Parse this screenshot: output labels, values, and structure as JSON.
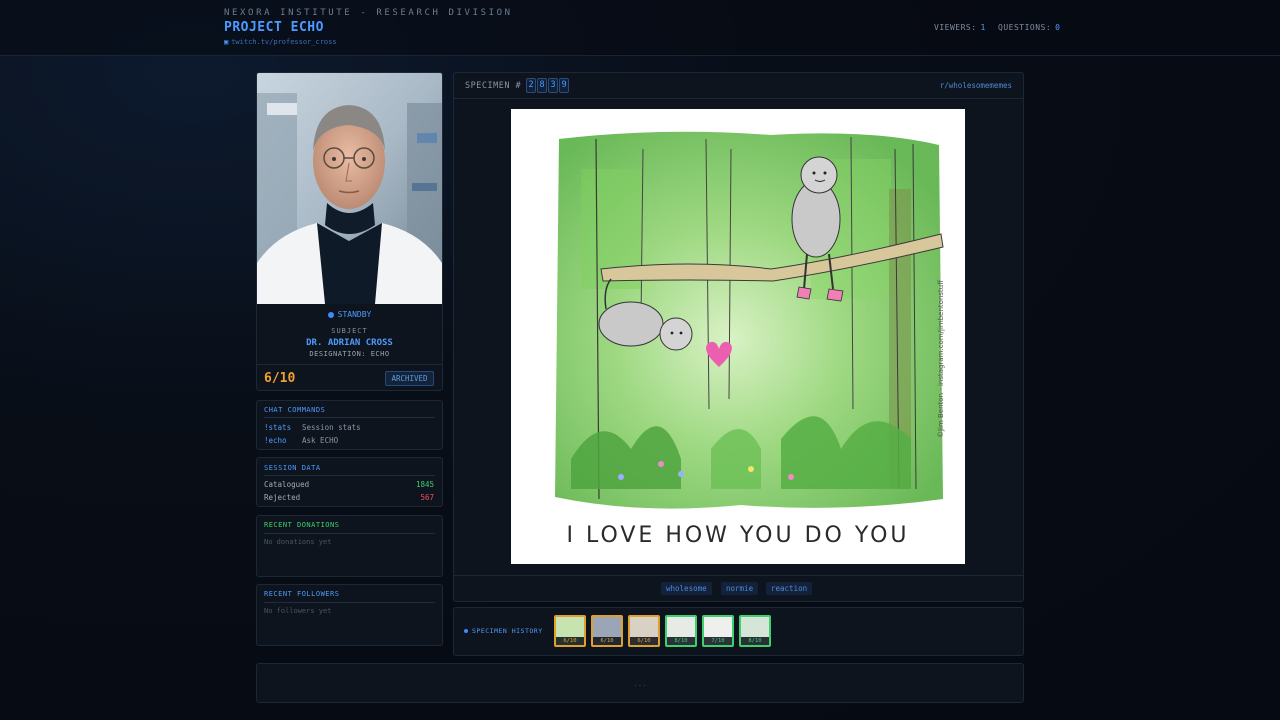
{
  "header": {
    "org": "NEXORA INSTITUTE - RESEARCH DIVISION",
    "project": "PROJECT ECHO",
    "channel": "twitch.tv/professor_cross",
    "viewers_label": "VIEWERS:",
    "viewers": "1",
    "questions_label": "QUESTIONS:",
    "questions": "0"
  },
  "subject": {
    "status": "STANDBY",
    "label": "SUBJECT",
    "name": "DR. ADRIAN CROSS",
    "designation": "DESIGNATION: ECHO",
    "score": "6/10",
    "badge": "ARCHIVED"
  },
  "commands": {
    "title": "CHAT COMMANDS",
    "items": [
      {
        "cmd": "!stats",
        "desc": "Session stats"
      },
      {
        "cmd": "!echo",
        "desc": "Ask ECHO"
      }
    ]
  },
  "session": {
    "title": "SESSION DATA",
    "rows": [
      {
        "key": "Catalogued",
        "value": "1845",
        "color": "#3ecf6e"
      },
      {
        "key": "Rejected",
        "value": "567",
        "color": "#ef4b5f"
      }
    ]
  },
  "donations": {
    "title": "RECENT DONATIONS",
    "empty": "No donations yet"
  },
  "followers": {
    "title": "RECENT FOLLOWERS",
    "empty": "No followers yet"
  },
  "specimen": {
    "label": "SPECIMEN #",
    "digits": [
      "2",
      "8",
      "3",
      "9"
    ],
    "subreddit": "r/wholesomememes",
    "caption": "I LOVE HOW YOU DO YOU",
    "credit": "©Jim Benton - instagram.com/jimbentonstuff",
    "tags": [
      "wholesome",
      "normie",
      "reaction"
    ]
  },
  "history": {
    "label": "SPECIMEN HISTORY",
    "items": [
      {
        "score": "6/10",
        "border": "#e0a030"
      },
      {
        "score": "6/10",
        "border": "#e0a030"
      },
      {
        "score": "6/10",
        "border": "#e0a030"
      },
      {
        "score": "8/10",
        "border": "#3ecf6e"
      },
      {
        "score": "7/10",
        "border": "#3ecf6e"
      },
      {
        "score": "8/10",
        "border": "#3ecf6e"
      }
    ]
  },
  "footer": {
    "text": "..."
  },
  "colors": {
    "accent": "#4d9bff",
    "warning": "#f0a030",
    "bg": "#080d16"
  }
}
